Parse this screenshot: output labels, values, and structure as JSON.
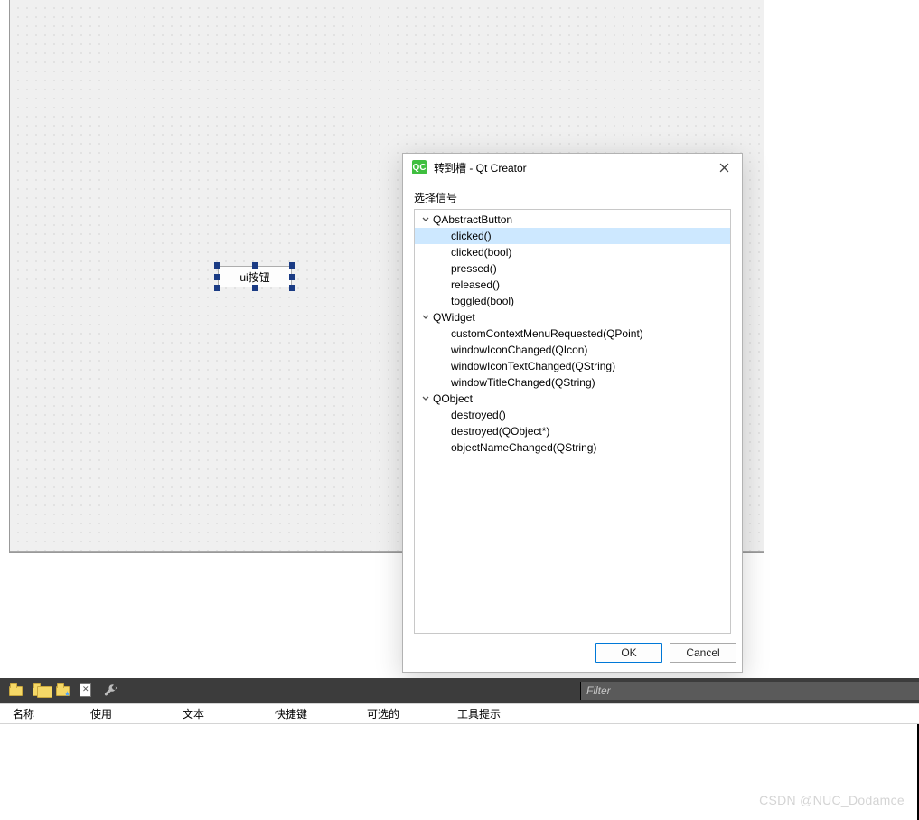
{
  "designer": {
    "button_text": "ui按钮"
  },
  "dialog": {
    "icon_text": "QC",
    "title": "转到槽 - Qt Creator",
    "select_signal_label": "选择信号",
    "ok_label": "OK",
    "cancel_label": "Cancel",
    "groups": [
      {
        "name": "QAbstractButton",
        "signals": [
          "clicked()",
          "clicked(bool)",
          "pressed()",
          "released()",
          "toggled(bool)"
        ],
        "selected_index": 0
      },
      {
        "name": "QWidget",
        "signals": [
          "customContextMenuRequested(QPoint)",
          "windowIconChanged(QIcon)",
          "windowIconTextChanged(QString)",
          "windowTitleChanged(QString)"
        ]
      },
      {
        "name": "QObject",
        "signals": [
          "destroyed()",
          "destroyed(QObject*)",
          "objectNameChanged(QString)"
        ]
      }
    ]
  },
  "toolbar": {
    "filter_placeholder": "Filter"
  },
  "headers": [
    "名称",
    "使用",
    "文本",
    "快捷键",
    "可选的",
    "工具提示"
  ],
  "watermark": "CSDN @NUC_Dodamce"
}
